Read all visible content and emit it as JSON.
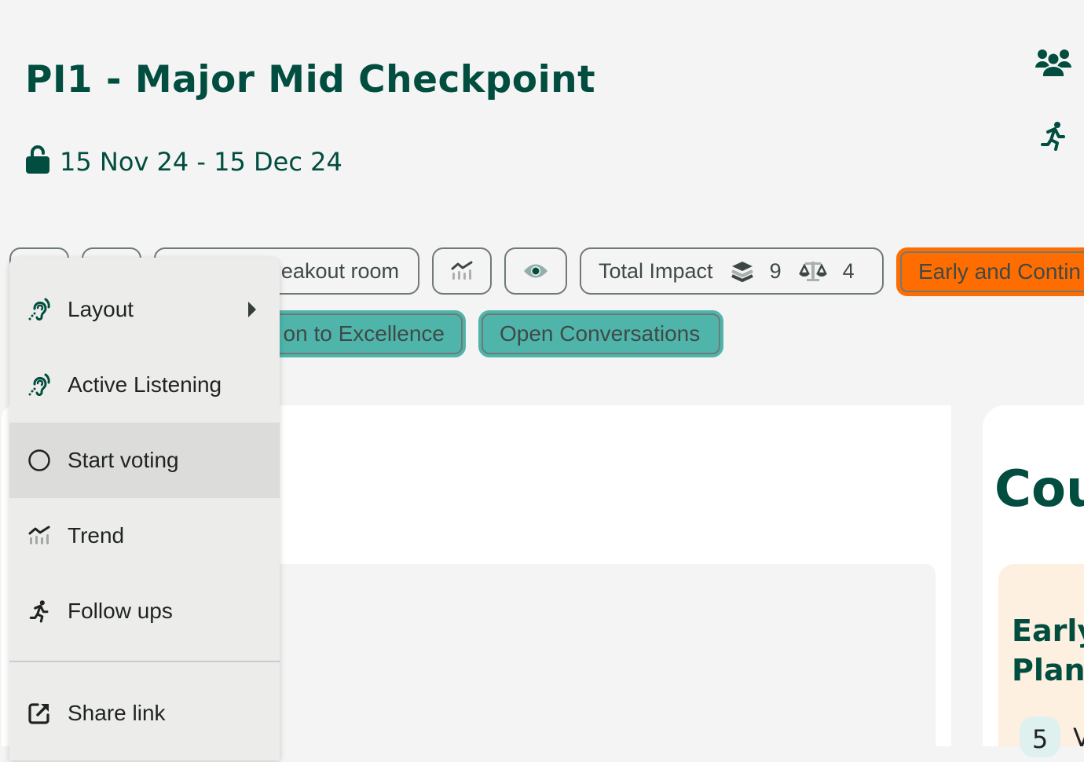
{
  "header": {
    "title": "PI1 - Major Mid Checkpoint",
    "date_range": "15 Nov 24 - 15 Dec 24",
    "lock_icon": "unlock-icon",
    "top_right_icons": [
      "participants-icon",
      "follow-ups-runner-icon"
    ]
  },
  "toolbar": {
    "breakout_label": "eakout room",
    "trend_icon": "trend-chart-icon",
    "visibility_icon": "eye-icon",
    "total_impact": {
      "label": "Total Impact",
      "layers_count": "9",
      "balance_count": "4"
    },
    "topic_orange_label": "Early and Contin",
    "tags": [
      {
        "label": "on to Excellence"
      },
      {
        "label": "Open Conversations"
      }
    ]
  },
  "menu": {
    "items": [
      {
        "label": "Layout",
        "icon": "ear-listening-icon",
        "has_submenu": true
      },
      {
        "label": "Active Listening",
        "icon": "ear-listening-icon"
      },
      {
        "label": "Start voting",
        "icon": "circle-icon",
        "highlighted": true
      },
      {
        "label": "Trend",
        "icon": "trend-chart-icon"
      },
      {
        "label": "Follow ups",
        "icon": "runner-icon"
      },
      {
        "label": "Share link",
        "icon": "external-link-icon"
      }
    ]
  },
  "right_panel": {
    "heading": "Cou",
    "card_title_line1": "Early",
    "card_title_line2": "Plann",
    "badge_value": "5",
    "badge_trailing_text": "V"
  },
  "colors": {
    "brand_green": "#014d3f",
    "teal_tag": "#4fb5ab",
    "orange_tag": "#ff6d00",
    "card_cream": "#fdf0e0"
  }
}
